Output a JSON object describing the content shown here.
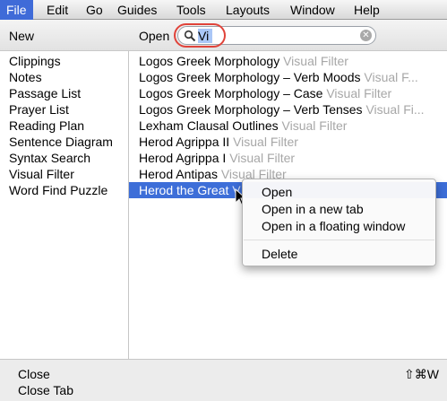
{
  "menubar": {
    "items": [
      "File",
      "Edit",
      "Go",
      "Guides",
      "Tools",
      "Layouts",
      "Window",
      "Help"
    ],
    "active": "File"
  },
  "panel": {
    "new_label": "New",
    "open_label": "Open",
    "search": {
      "value": "Vi"
    },
    "new_items": [
      "Clippings",
      "Notes",
      "Passage List",
      "Prayer List",
      "Reading Plan",
      "Sentence Diagram",
      "Syntax Search",
      "Visual Filter",
      "Word Find Puzzle"
    ],
    "open_items": [
      {
        "name": "Logos Greek Morphology",
        "kind": "Visual Filter"
      },
      {
        "name": "Logos Greek Morphology – Verb Moods",
        "kind": "Visual F..."
      },
      {
        "name": "Logos Greek Morphology – Case",
        "kind": "Visual Filter"
      },
      {
        "name": "Logos Greek Morphology – Verb Tenses",
        "kind": "Visual Fi..."
      },
      {
        "name": "Lexham Clausal Outlines",
        "kind": "Visual Filter"
      },
      {
        "name": "Herod Agrippa II",
        "kind": "Visual Filter"
      },
      {
        "name": "Herod Agrippa I",
        "kind": "Visual Filter"
      },
      {
        "name": "Herod Antipas",
        "kind": "Visual Filter"
      },
      {
        "name": "Herod the Great",
        "kind": "V"
      }
    ],
    "selected_index": 8
  },
  "context_menu": {
    "items": [
      "Open",
      "Open in a new tab",
      "Open in a floating window"
    ],
    "delete_label": "Delete"
  },
  "footer": {
    "close_label": "Close",
    "close_tab_label": "Close Tab",
    "close_shortcut": "⇧⌘W"
  },
  "colors": {
    "selection": "#3d6ed8",
    "highlight_ring": "#e0433a",
    "dim_text": "#a7a7a7"
  }
}
